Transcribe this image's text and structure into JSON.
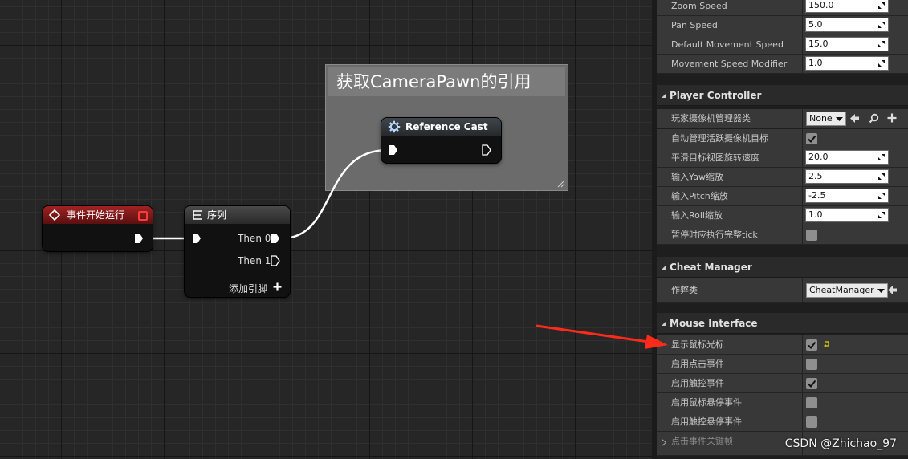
{
  "graph": {
    "comment_title": "获取CameraPawn的引用",
    "nodes": {
      "begin_play": {
        "title": "事件开始运行",
        "color": "#7a1a1a"
      },
      "sequence": {
        "title": "序列",
        "pins": [
          "Then 0",
          "Then 1"
        ],
        "add_pin": "添加引脚",
        "color": "#3a3a3a"
      },
      "reference_cast": {
        "title": "Reference Cast",
        "color": "#2f3336"
      }
    }
  },
  "details": {
    "top_rows": [
      {
        "label": "Zoom Speed",
        "value": "150.0"
      },
      {
        "label": "Pan Speed",
        "value": "5.0"
      },
      {
        "label": "Default Movement Speed",
        "value": "15.0"
      },
      {
        "label": "Movement Speed Modifier",
        "value": "1.0"
      }
    ],
    "player_controller": {
      "header": "Player Controller",
      "camera_manager_label": "玩家摄像机管理器类",
      "camera_manager_value": "None",
      "auto_manage_label": "自动管理活跃摄像机目标",
      "auto_manage_checked": true,
      "rows": [
        {
          "label": "平滑目标视图旋转速度",
          "value": "20.0"
        },
        {
          "label": "输入Yaw缩放",
          "value": "2.5"
        },
        {
          "label": "输入Pitch缩放",
          "value": "-2.5"
        },
        {
          "label": "输入Roll缩放",
          "value": "1.0"
        }
      ],
      "tick_pause_label": "暂停时应执行完整tick",
      "tick_pause_checked": false
    },
    "cheat_manager": {
      "header": "Cheat Manager",
      "class_label": "作弊类",
      "class_value": "CheatManager"
    },
    "mouse_interface": {
      "header": "Mouse Interface",
      "rows": [
        {
          "label": "显示鼠标光标",
          "checked": true
        },
        {
          "label": "启用点击事件",
          "checked": false
        },
        {
          "label": "启用触控事件",
          "checked": true
        },
        {
          "label": "启用鼠标悬停事件",
          "checked": false
        },
        {
          "label": "启用触控悬停事件",
          "checked": false
        }
      ],
      "collapsed_row": "点击事件关键帧"
    }
  },
  "watermark": "CSDN @Zhichao_97"
}
